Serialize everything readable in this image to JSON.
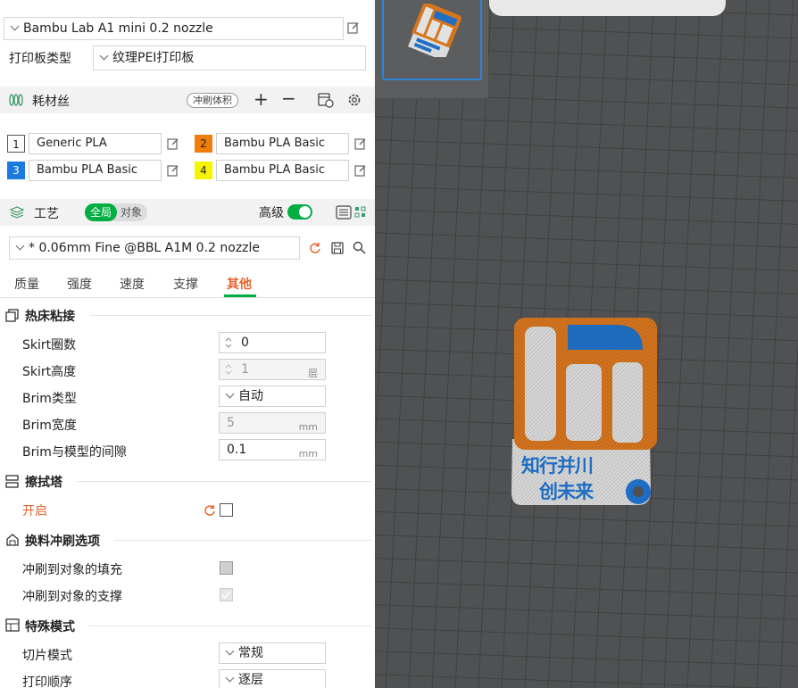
{
  "printer": {
    "name": "Bambu Lab A1 mini 0.2 nozzle"
  },
  "plate": {
    "label": "打印板类型",
    "value": "纹理PEI打印板"
  },
  "filament": {
    "title": "耗材丝",
    "flush_btn": "冲刷体积",
    "items": [
      {
        "index": "1",
        "name": "Generic PLA",
        "color": "#ffffff"
      },
      {
        "index": "2",
        "name": "Bambu PLA Basic",
        "color": "#f07d0a"
      },
      {
        "index": "3",
        "name": "Bambu PLA Basic",
        "color": "#1a7ae0"
      },
      {
        "index": "4",
        "name": "Bambu PLA Basic",
        "color": "#f5f500"
      }
    ]
  },
  "process": {
    "title": "工艺",
    "toggle_global": "全局",
    "toggle_object": "对象",
    "advanced_label": "高级",
    "preset": "* 0.06mm Fine @BBL A1M 0.2 nozzle"
  },
  "tabs": [
    {
      "label": "质量"
    },
    {
      "label": "强度"
    },
    {
      "label": "速度"
    },
    {
      "label": "支撑"
    },
    {
      "label": "其他"
    }
  ],
  "bed_adhesion": {
    "title": "热床粘接",
    "skirt_loops": {
      "label": "Skirt圈数",
      "value": "0"
    },
    "skirt_height": {
      "label": "Skirt高度",
      "value": "1",
      "unit": "层"
    },
    "brim_type": {
      "label": "Brim类型",
      "value": "自动"
    },
    "brim_width": {
      "label": "Brim宽度",
      "value": "5",
      "unit": "mm"
    },
    "brim_gap": {
      "label": "Brim与模型的间隙",
      "value": "0.1",
      "unit": "mm"
    }
  },
  "prime_tower": {
    "title": "擦拭塔",
    "enable": {
      "label": "开启"
    }
  },
  "flush_options": {
    "title": "换料冲刷选项",
    "infill": {
      "label": "冲刷到对象的填充"
    },
    "support": {
      "label": "冲刷到对象的支撑"
    }
  },
  "special_mode": {
    "title": "特殊模式",
    "slicing_mode": {
      "label": "切片模式",
      "value": "常规"
    },
    "print_sequence": {
      "label": "打印顺序",
      "value": "逐层"
    }
  },
  "model": {
    "text_line1": "知行并川",
    "text_line2": "创未来"
  },
  "colors": {
    "accent_green": "#00ae42",
    "accent_orange": "#e8632b",
    "model_orange": "#d5761e",
    "model_blue": "#1d6ec4",
    "model_white": "#d6d6d6"
  }
}
